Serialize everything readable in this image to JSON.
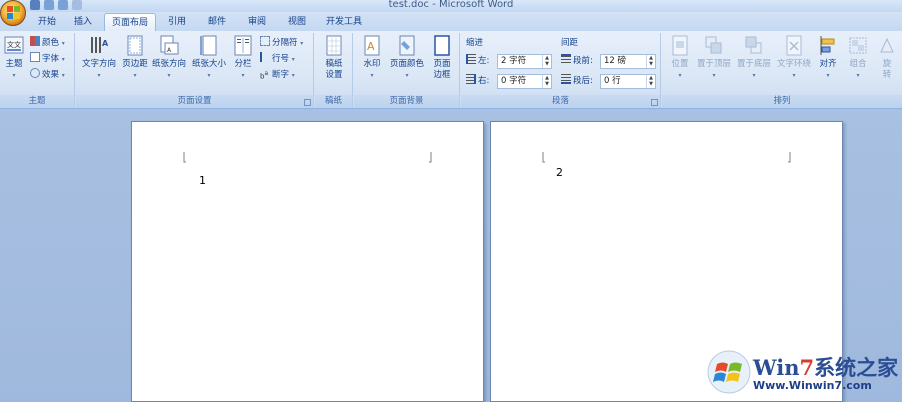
{
  "window": {
    "title": "test.doc - Microsoft Word"
  },
  "tabs": [
    "开始",
    "插入",
    "页面布局",
    "引用",
    "邮件",
    "审阅",
    "视图",
    "开发工具"
  ],
  "active_tab": "页面布局",
  "ribbon": {
    "theme": {
      "group_label": "主题",
      "main_label": "主题",
      "colors": "颜色",
      "fonts": "字体",
      "effects": "效果"
    },
    "page_setup": {
      "group_label": "页面设置",
      "text_direction": "文字方向",
      "margins": "页边距",
      "orientation": "纸张方向",
      "size": "纸张大小",
      "columns": "分栏",
      "breaks": "分隔符",
      "line_numbers": "行号",
      "hyphenation": "断字"
    },
    "manuscript": {
      "group_label": "稿纸",
      "setup_line1": "稿纸",
      "setup_line2": "设置"
    },
    "page_background": {
      "group_label": "页面背景",
      "watermark": "水印",
      "page_color": "页面颜色",
      "borders_line1": "页面",
      "borders_line2": "边框"
    },
    "paragraph": {
      "group_label": "段落",
      "indent_title": "缩进",
      "indent_left_label": "左:",
      "indent_left_value": "2 字符",
      "indent_right_label": "右:",
      "indent_right_value": "0 字符",
      "spacing_title": "间距",
      "spacing_before_label": "段前:",
      "spacing_before_value": "12 磅",
      "spacing_after_label": "段后:",
      "spacing_after_value": "0 行"
    },
    "arrange": {
      "group_label": "排列",
      "position": "位置",
      "bring_front": "置于顶层",
      "send_back": "置于底层",
      "text_wrap": "文字环绕",
      "align": "对齐",
      "group": "组合",
      "rotate_line1": "旋",
      "rotate_line2": "转"
    }
  },
  "document": {
    "page1_text": "1",
    "page2_text": "2"
  },
  "watermark": {
    "brand_a": "Win",
    "brand_b": "7",
    "brand_c": "系统之家",
    "url": "Www.Winwin7.com"
  },
  "colors": {
    "ribbon_top": "#e7effa",
    "doc_bg": "#a8c0e1",
    "text": "#15428b",
    "page": "#ffffff"
  }
}
